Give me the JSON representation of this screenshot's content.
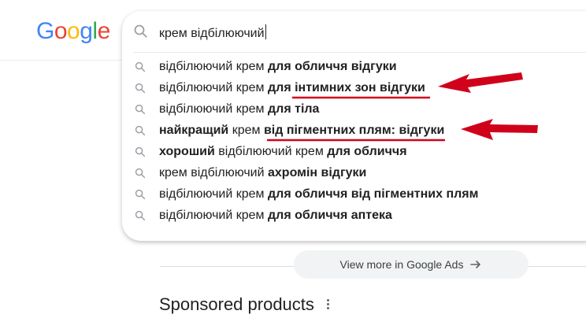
{
  "logo": {
    "letters": [
      "G",
      "o",
      "o",
      "g",
      "l",
      "e"
    ],
    "colors": [
      "#4285F4",
      "#EA4335",
      "#FBBC05",
      "#4285F4",
      "#34A853",
      "#EA4335"
    ]
  },
  "search": {
    "query": "крем відбілюючий",
    "icon": "search-icon"
  },
  "suggestions": [
    {
      "normal": "відбілюючий крем ",
      "bold": "для обличчя відгуки",
      "tail": ""
    },
    {
      "normal": "відбілюючий крем ",
      "bold": "для інтимних зон відгуки",
      "tail": ""
    },
    {
      "normal": "відбілюючий крем ",
      "bold": "для тіла",
      "tail": ""
    },
    {
      "bold_lead": "найкращий",
      "normal": " крем ",
      "bold": "від пігментних плям: відгуки",
      "tail": ""
    },
    {
      "bold_lead": "хороший",
      "normal": " відбілюючий крем ",
      "bold": "для обличчя",
      "tail": ""
    },
    {
      "normal": "крем відбілюючий ",
      "bold": "ахромін відгуки",
      "tail": ""
    },
    {
      "normal": "відбілюючий крем ",
      "bold": "для обличчя від пігментних плям",
      "tail": ""
    },
    {
      "normal": "відбілюючий крем ",
      "bold": "для обличчя аптека",
      "tail": ""
    }
  ],
  "annotation_color": "#d0021b",
  "view_more": {
    "label": "View more in Google Ads",
    "icon": "arrow-right-icon"
  },
  "sponsored": {
    "title": "Sponsored products",
    "icon": "more-vert-icon"
  }
}
